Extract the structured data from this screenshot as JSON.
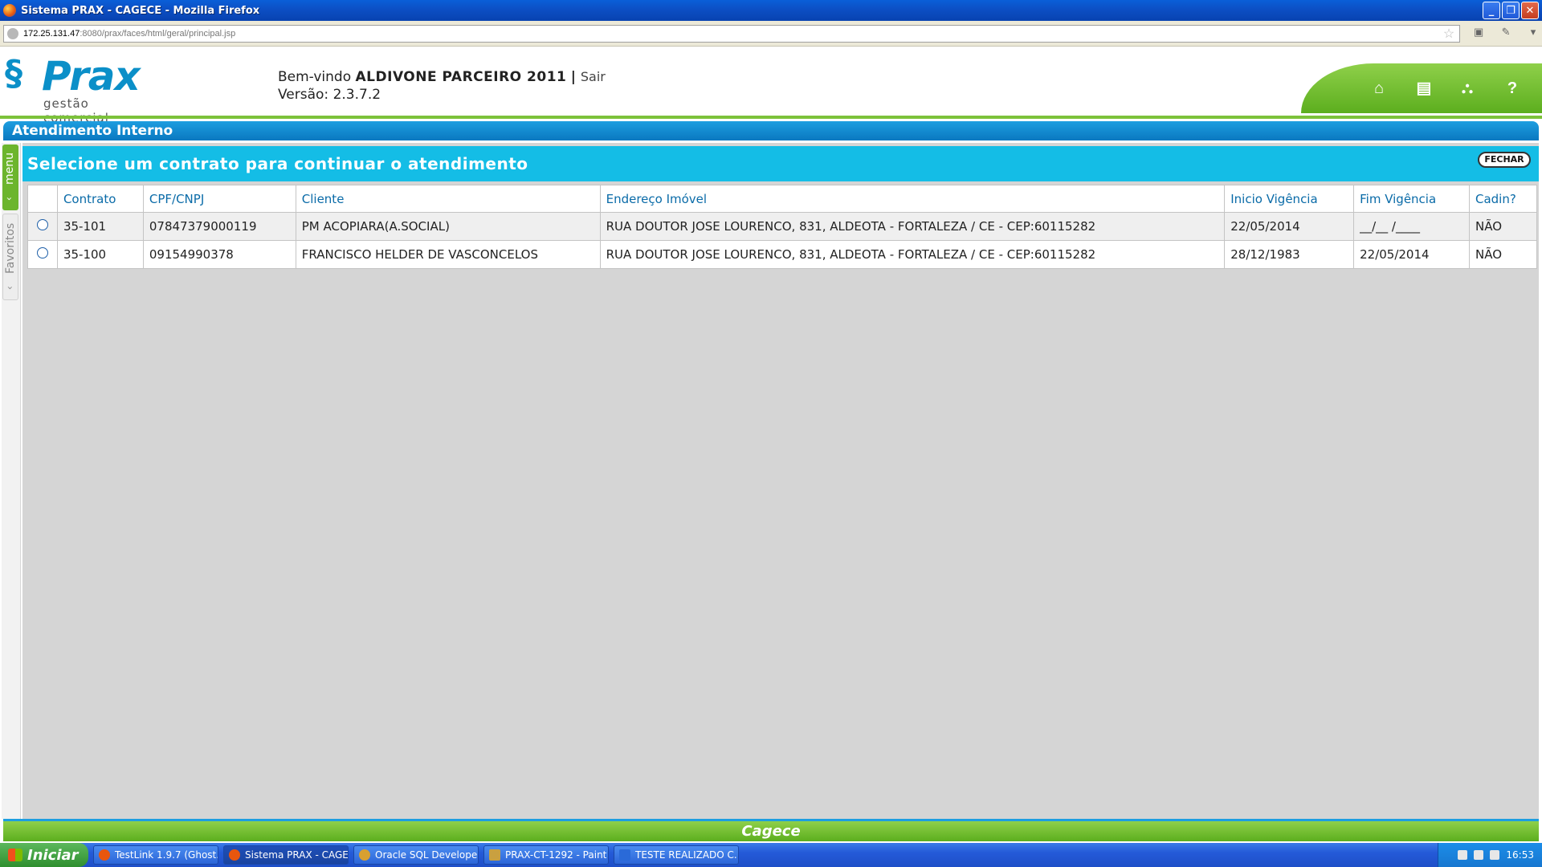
{
  "window": {
    "title": "Sistema PRAX - CAGECE - Mozilla Firefox",
    "url_host": "172.25.131.47",
    "url_rest": ":8080/prax/faces/html/geral/principal.jsp"
  },
  "header": {
    "logo_name": "Prax",
    "logo_sub": "gestão comercial",
    "welcome_prefix": "Bem-vindo",
    "user": "ALDIVONE PARCEIRO 2011",
    "separator": "|",
    "logout": "Sair",
    "version": "Versão: 2.3.7.2",
    "toolbar_icons": [
      "home-icon",
      "print-icon",
      "sitemap-icon",
      "help-icon"
    ]
  },
  "section": {
    "title": "Atendimento Interno"
  },
  "side_tabs": {
    "menu": "menu",
    "favorites": "Favoritos"
  },
  "dialog": {
    "title": "Selecione um contrato para continuar o atendimento",
    "close_label": "FECHAR"
  },
  "table": {
    "headers": [
      "Contrato",
      "CPF/CNPJ",
      "Cliente",
      "Endereço Imóvel",
      "Inicio Vigência",
      "Fim Vigência",
      "Cadin?"
    ],
    "rows": [
      {
        "contrato": "35-101",
        "cpf": "07847379000119",
        "cliente": "PM ACOPIARA(A.SOCIAL)",
        "endereco": "RUA DOUTOR JOSE LOURENCO, 831, ALDEOTA - FORTALEZA / CE - CEP:60115282",
        "inicio": "22/05/2014",
        "fim": "__/__ /____",
        "cadin": "NÃO"
      },
      {
        "contrato": "35-100",
        "cpf": "09154990378",
        "cliente": "FRANCISCO HELDER DE VASCONCELOS",
        "endereco": "RUA DOUTOR JOSE LOURENCO, 831, ALDEOTA - FORTALEZA / CE - CEP:60115282",
        "inicio": "28/12/1983",
        "fim": "22/05/2014",
        "cadin": "NÃO"
      }
    ]
  },
  "footer": {
    "brand": "Cagece"
  },
  "taskbar": {
    "start": "Iniciar",
    "tasks": [
      "TestLink 1.9.7 (Ghost...",
      "Sistema PRAX - CAGE...",
      "Oracle SQL Develope...",
      "PRAX-CT-1292 - Paint",
      "TESTE REALIZADO C..."
    ],
    "clock": "16:53"
  }
}
